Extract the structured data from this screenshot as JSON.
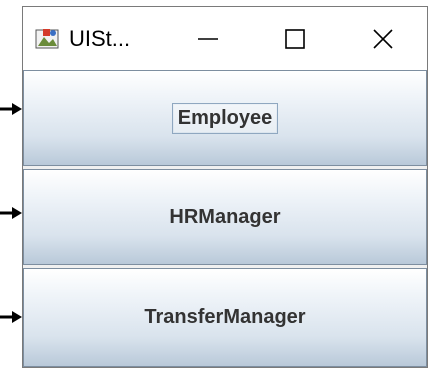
{
  "window": {
    "title": "UISt..."
  },
  "controls": {
    "minimize": "minimize",
    "maximize": "maximize",
    "close": "close"
  },
  "buttons": [
    {
      "label": "Employee",
      "focused": true
    },
    {
      "label": "HRManager",
      "focused": false
    },
    {
      "label": "TransferManager",
      "focused": false
    }
  ],
  "colors": {
    "titlebar": "#ffffff",
    "button_top": "#ffffff",
    "button_bottom": "#b9c9d9",
    "button_border": "#7d8ea0",
    "label": "#333333"
  }
}
